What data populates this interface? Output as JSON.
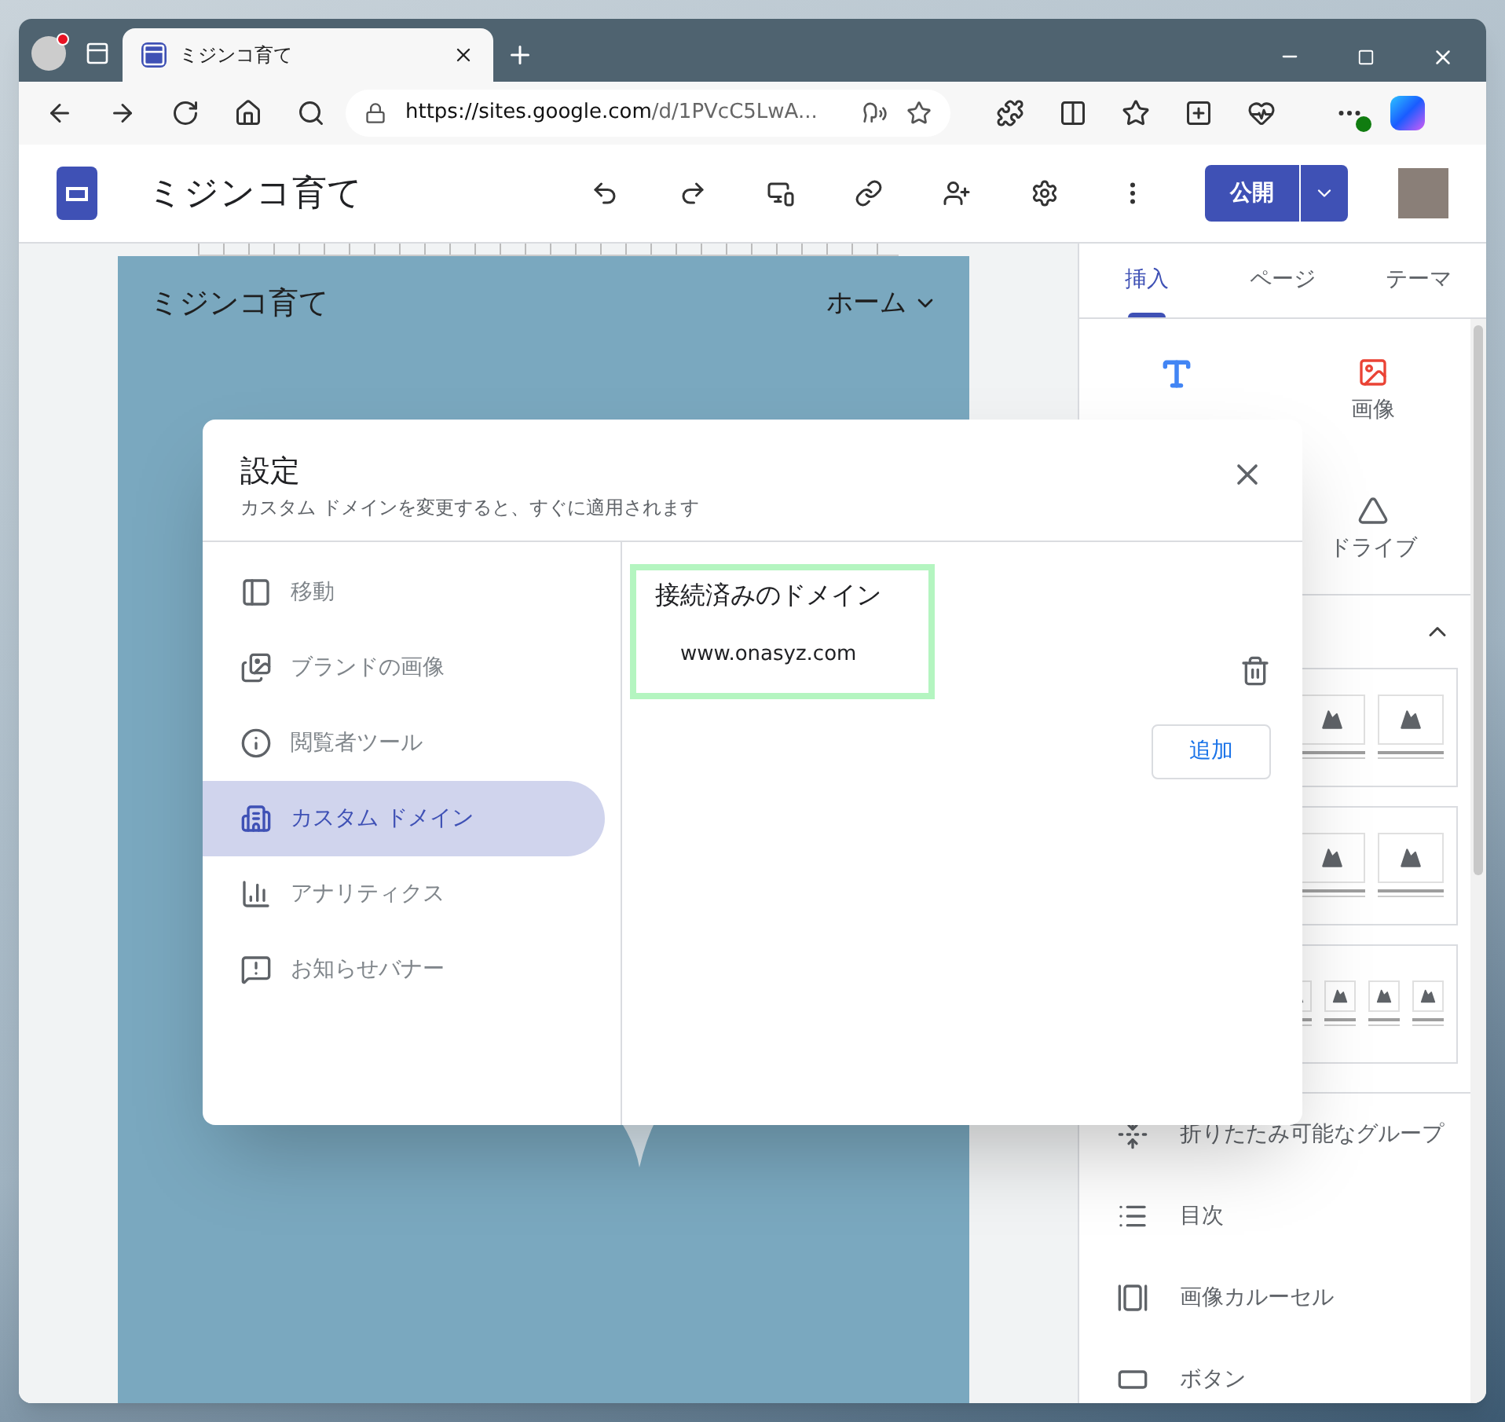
{
  "browser": {
    "tab_title": "ミジンコ育て",
    "url_host": "https://sites.google.com",
    "url_path": "/d/1PVcC5LwA..."
  },
  "app": {
    "title": "ミジンコ育て",
    "publish_button": "公開"
  },
  "canvas": {
    "site_title": "ミジンコ育て",
    "nav_item": "ホーム"
  },
  "panel": {
    "tabs": [
      {
        "label": "挿入",
        "selected": true
      },
      {
        "label": "ページ",
        "selected": false
      },
      {
        "label": "テーマ",
        "selected": false
      }
    ],
    "insert_items": [
      {
        "kind": "image",
        "label": "画像"
      },
      {
        "kind": "drive",
        "label": "ドライブ"
      }
    ],
    "list_items": [
      {
        "kind": "collapsible",
        "label": "折りたたみ可能なグループ"
      },
      {
        "kind": "toc",
        "label": "目次"
      },
      {
        "kind": "carousel",
        "label": "画像カルーセル"
      },
      {
        "kind": "button",
        "label": "ボタン"
      }
    ]
  },
  "dialog": {
    "title": "設定",
    "subtitle": "カスタム ドメインを変更すると、すぐに適用されます",
    "nav": [
      {
        "kind": "navigation",
        "label": "移動",
        "selected": false
      },
      {
        "kind": "brand",
        "label": "ブランドの画像",
        "selected": false
      },
      {
        "kind": "viewer",
        "label": "閲覧者ツール",
        "selected": false
      },
      {
        "kind": "domain",
        "label": "カスタム ドメイン",
        "selected": true
      },
      {
        "kind": "analytics",
        "label": "アナリティクス",
        "selected": false
      },
      {
        "kind": "banner",
        "label": "お知らせバナー",
        "selected": false
      }
    ],
    "section_title": "接続済みのドメイン",
    "domain": "www.onasyz.com",
    "add_button": "追加"
  }
}
